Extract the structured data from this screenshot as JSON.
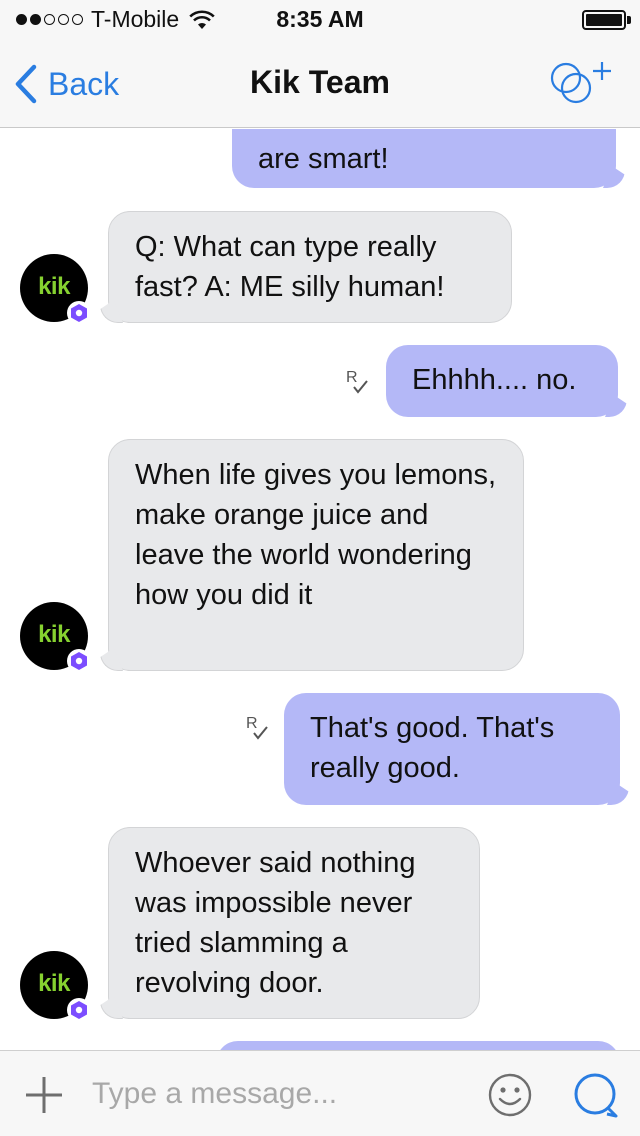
{
  "status_bar": {
    "carrier": "T-Mobile",
    "time": "8:35 AM",
    "signal_icon": "signal-dots-icon",
    "wifi_icon": "wifi-icon",
    "battery_icon": "battery-icon"
  },
  "nav": {
    "back_label": "Back",
    "title": "Kik Team",
    "back_icon": "chevron-left-icon",
    "add_icon": "add-people-icon"
  },
  "messages": [
    {
      "direction": "out",
      "text": "are smart!"
    },
    {
      "direction": "in",
      "text": "Q: What can type really fast? A: ME silly human!"
    },
    {
      "direction": "out",
      "text": "Ehhhh.... no.",
      "receipt": "R"
    },
    {
      "direction": "in",
      "text": "When life gives you lemons, make orange juice and leave the world wondering how you did it"
    },
    {
      "direction": "out",
      "text": "That's good. That's really good.",
      "receipt": "R"
    },
    {
      "direction": "in",
      "text": "Whoever said nothing was impossible never tried slamming a revolving door."
    }
  ],
  "avatar": {
    "text": "kik",
    "badge_icon": "verified-badge-icon"
  },
  "input_bar": {
    "placeholder": "Type a message...",
    "value": "",
    "plus_icon": "plus-icon",
    "emoji_icon": "smiley-icon",
    "search_icon": "chat-bubble-icon"
  },
  "colors": {
    "accent": "#2a7de1",
    "outgoing_bubble": "#b4b8f7",
    "incoming_bubble": "#e8e9eb",
    "kik_green": "#86d130",
    "badge_purple": "#7c4dff"
  }
}
